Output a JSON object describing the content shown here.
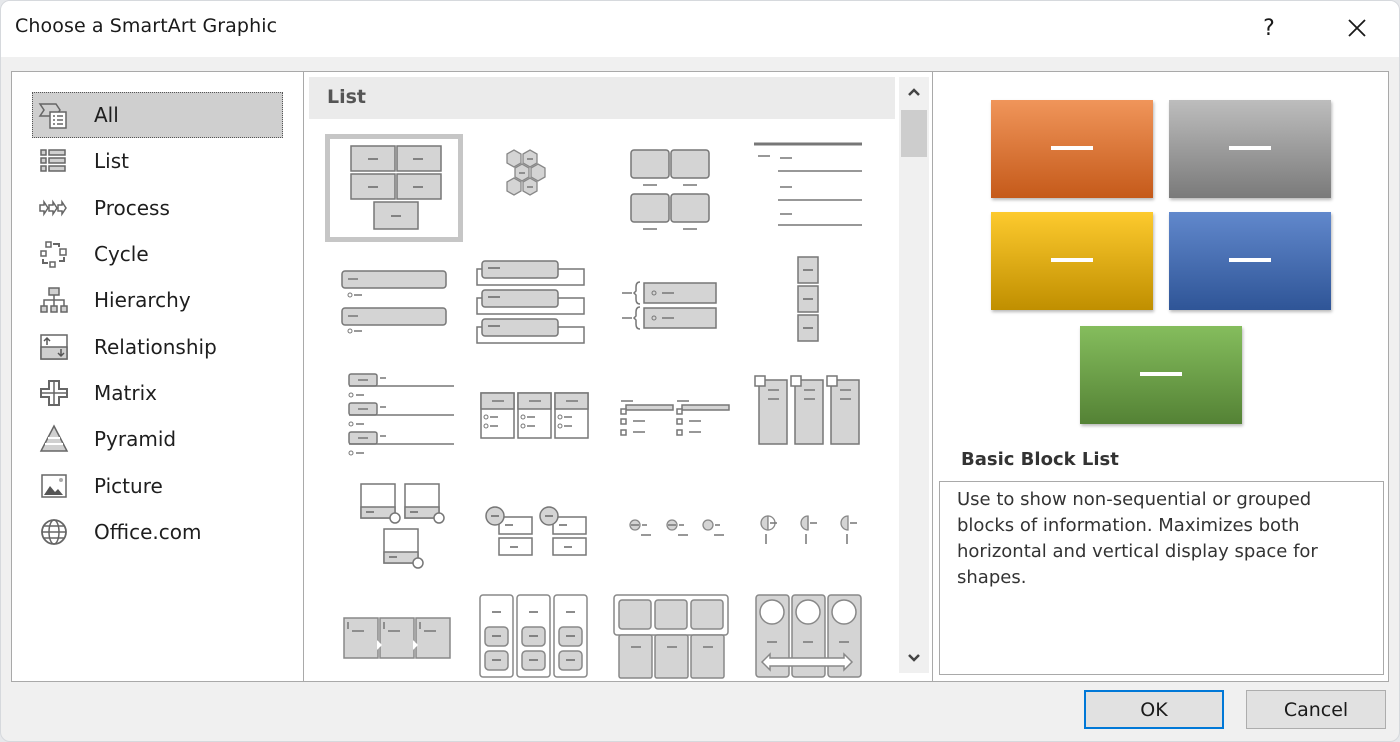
{
  "window": {
    "title": "Choose a SmartArt Graphic",
    "help_label": "?",
    "close_label": "✕"
  },
  "sidebar": {
    "selected": "All",
    "items": [
      {
        "label": "All",
        "icon": "all-icon"
      },
      {
        "label": "List",
        "icon": "list-icon"
      },
      {
        "label": "Process",
        "icon": "process-icon"
      },
      {
        "label": "Cycle",
        "icon": "cycle-icon"
      },
      {
        "label": "Hierarchy",
        "icon": "hierarchy-icon"
      },
      {
        "label": "Relationship",
        "icon": "relationship-icon"
      },
      {
        "label": "Matrix",
        "icon": "matrix-icon"
      },
      {
        "label": "Pyramid",
        "icon": "pyramid-icon"
      },
      {
        "label": "Picture",
        "icon": "picture-icon"
      },
      {
        "label": "Office.com",
        "icon": "globe-icon"
      }
    ]
  },
  "gallery": {
    "section_title": "List",
    "scroll_up_label": "⌃",
    "scroll_down_label": "⌄",
    "selected_index": 0,
    "layouts": [
      "basic-block-list",
      "hexagon-cluster",
      "picture-caption-list",
      "lined-list",
      "vertical-bullet-list",
      "vertical-box-list",
      "vertical-bracket-list",
      "stacked-list",
      "trapezoid-list",
      "grouped-list",
      "table-list",
      "tab-list",
      "picture-accent-list",
      "circle-accent-list",
      "circle-dot-list",
      "pie-timeline-list",
      "process-arrow-list",
      "horizontal-bullet-list",
      "table-hierarchy-list",
      "circle-arrow-list"
    ]
  },
  "preview": {
    "name": "Basic Block List",
    "description": "Use to show non-sequential or grouped blocks of information. Maximizes both horizontal and vertical display space for shapes.",
    "blocks": [
      {
        "color_top": "#f0955a",
        "color_bottom": "#c55a1a"
      },
      {
        "color_top": "#bdbdbd",
        "color_bottom": "#7a7a7a"
      },
      {
        "color_top": "#fdca2e",
        "color_bottom": "#c08f00"
      },
      {
        "color_top": "#6188cc",
        "color_bottom": "#2f5597"
      },
      {
        "color_top": "#85bd5d",
        "color_bottom": "#548235"
      }
    ]
  },
  "buttons": {
    "ok_label": "OK",
    "cancel_label": "Cancel"
  }
}
